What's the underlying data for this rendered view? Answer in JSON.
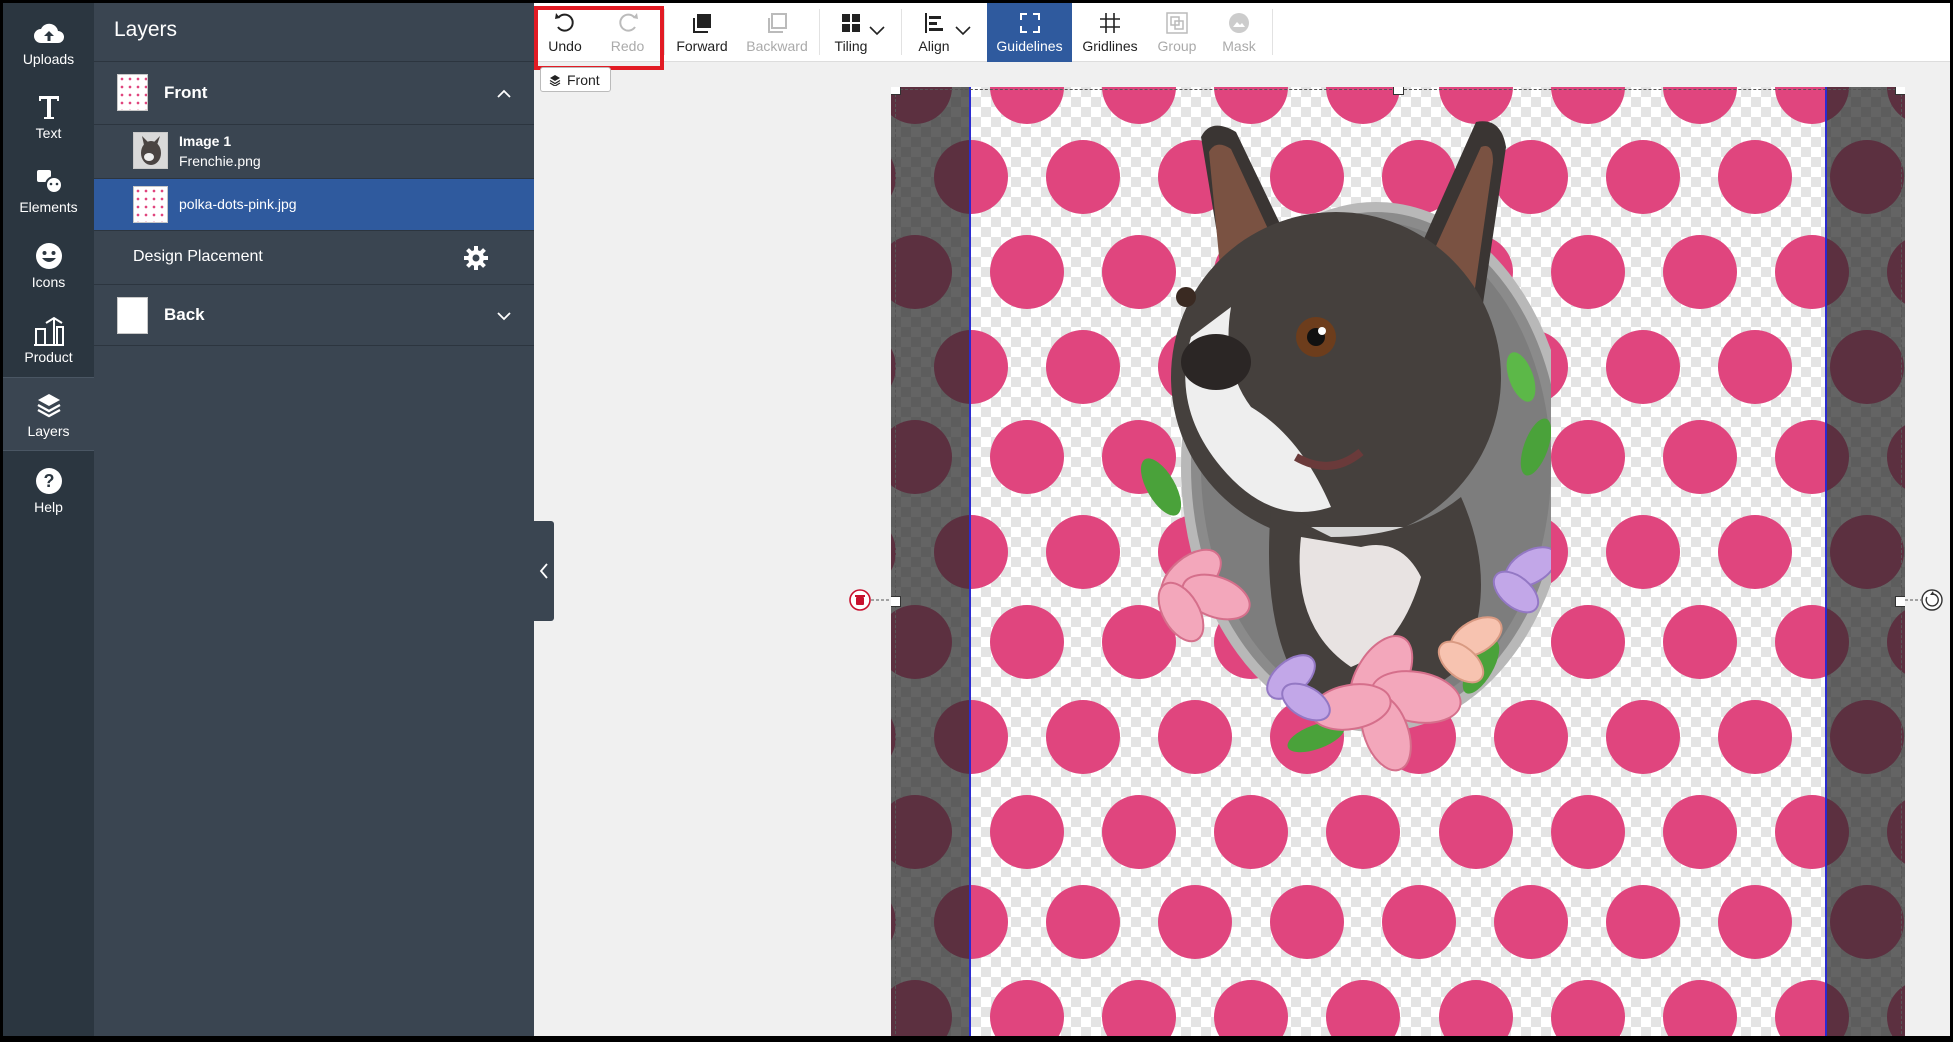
{
  "rail": {
    "items": [
      {
        "label": "Uploads",
        "icon": "cloud-upload-icon"
      },
      {
        "label": "Text",
        "icon": "text-icon"
      },
      {
        "label": "Elements",
        "icon": "elements-icon"
      },
      {
        "label": "Icons",
        "icon": "smiley-icon"
      },
      {
        "label": "Product",
        "icon": "product-icon"
      },
      {
        "label": "Layers",
        "icon": "layers-icon"
      },
      {
        "label": "Help",
        "icon": "help-icon"
      }
    ],
    "active": "Layers"
  },
  "layers_panel": {
    "title": "Layers",
    "front": {
      "label": "Front",
      "expanded": true
    },
    "layers": [
      {
        "title": "Image 1",
        "file": "Frenchie.png",
        "selected": false
      },
      {
        "file": "polka-dots-pink.jpg",
        "selected": true
      }
    ],
    "design_placement": "Design Placement",
    "back": {
      "label": "Back",
      "expanded": false
    }
  },
  "toolbar": {
    "undo": "Undo",
    "redo": "Redo",
    "forward": "Forward",
    "backward": "Backward",
    "tiling": "Tiling",
    "align": "Align",
    "guidelines": "Guidelines",
    "gridlines": "Gridlines",
    "group": "Group",
    "mask": "Mask"
  },
  "canvas": {
    "side_tag": "Front",
    "pattern_color": "#e0457e",
    "selection_color": "#2a2bd0"
  },
  "colors": {
    "rail_bg": "#2b3640",
    "panel_bg": "#3a4551",
    "selected_row": "#2f5a9e",
    "highlight": "#e21b24"
  }
}
